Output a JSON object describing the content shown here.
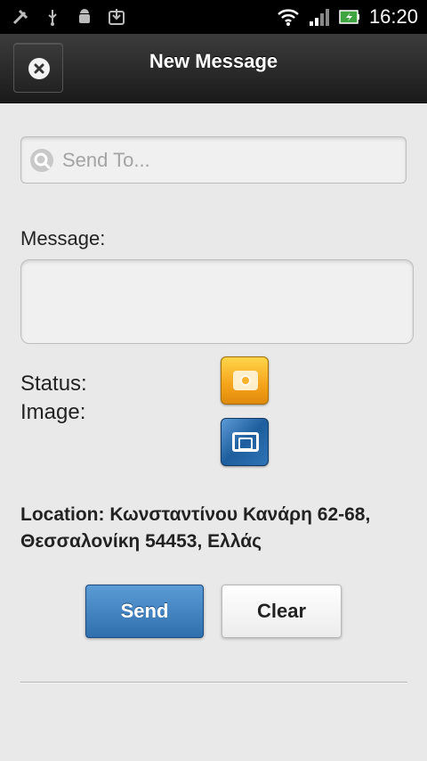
{
  "status_bar": {
    "time": "16:20",
    "icons_left": [
      "signal-off-icon",
      "usb-icon",
      "android-debug-icon",
      "download-icon"
    ],
    "icons_right": [
      "wifi-icon",
      "cell-signal-icon",
      "battery-charging-icon"
    ]
  },
  "header": {
    "title": "New Message",
    "close_icon": "close-icon"
  },
  "form": {
    "search_placeholder": "Send To...",
    "message_label": "Message:",
    "status_label": "Status:",
    "image_label": "Image:",
    "location_text": "Location: Κωνσταντίνου Κανάρη 62-68, Θεσσαλονίκη 54453, Ελλάς"
  },
  "buttons": {
    "send_label": "Send",
    "clear_label": "Clear"
  },
  "colors": {
    "accent_blue": "#2f6fad",
    "camera_orange": "#f4a31a",
    "header_dark": "#1a1a1a",
    "background": "#e9e9e9"
  }
}
